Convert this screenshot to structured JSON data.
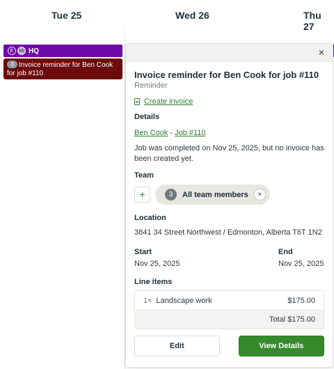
{
  "calendar": {
    "days": [
      "Tue 25",
      "Wed 26",
      "Thu 27"
    ],
    "colors": {
      "event_bar": "#6f0aa8",
      "task_card": "#6b0b0b"
    },
    "event_bar": {
      "avatar1": "E",
      "avatar2": "MI",
      "label": "HQ"
    },
    "task_card": {
      "count": "3",
      "label": "Invoice reminder for Ben Cook for job #110"
    }
  },
  "popover": {
    "close_icon": "×",
    "title": "Invoice reminder for Ben Cook for job #110",
    "subtitle": "Reminder",
    "create_invoice_label": "Create invoice",
    "details_label": "Details",
    "client_link": "Ben Cook",
    "separator": " - ",
    "job_link": "Job #110",
    "description": "Job was completed on Nov 25, 2025, but no invoice has been created yet.",
    "team": {
      "label": "Team",
      "add_label": "+",
      "chip_count": "3",
      "chip_label": "All team members",
      "chip_remove": "×"
    },
    "location": {
      "label": "Location",
      "address": "3841 34 Street Northwest / Edmonton, Alberta T6T 1N2"
    },
    "start": {
      "label": "Start",
      "value": "Nov 25, 2025"
    },
    "end": {
      "label": "End",
      "value": "Nov 25, 2025"
    },
    "line_items": {
      "label": "Line items",
      "items": [
        {
          "qty": "1×",
          "name": "Landscape work",
          "price": "$175.00"
        }
      ],
      "total": "Total $175.00"
    },
    "buttons": {
      "edit": "Edit",
      "view": "View Details"
    },
    "colors": {
      "accent": "#358a2b",
      "link": "#2e7d32"
    }
  }
}
